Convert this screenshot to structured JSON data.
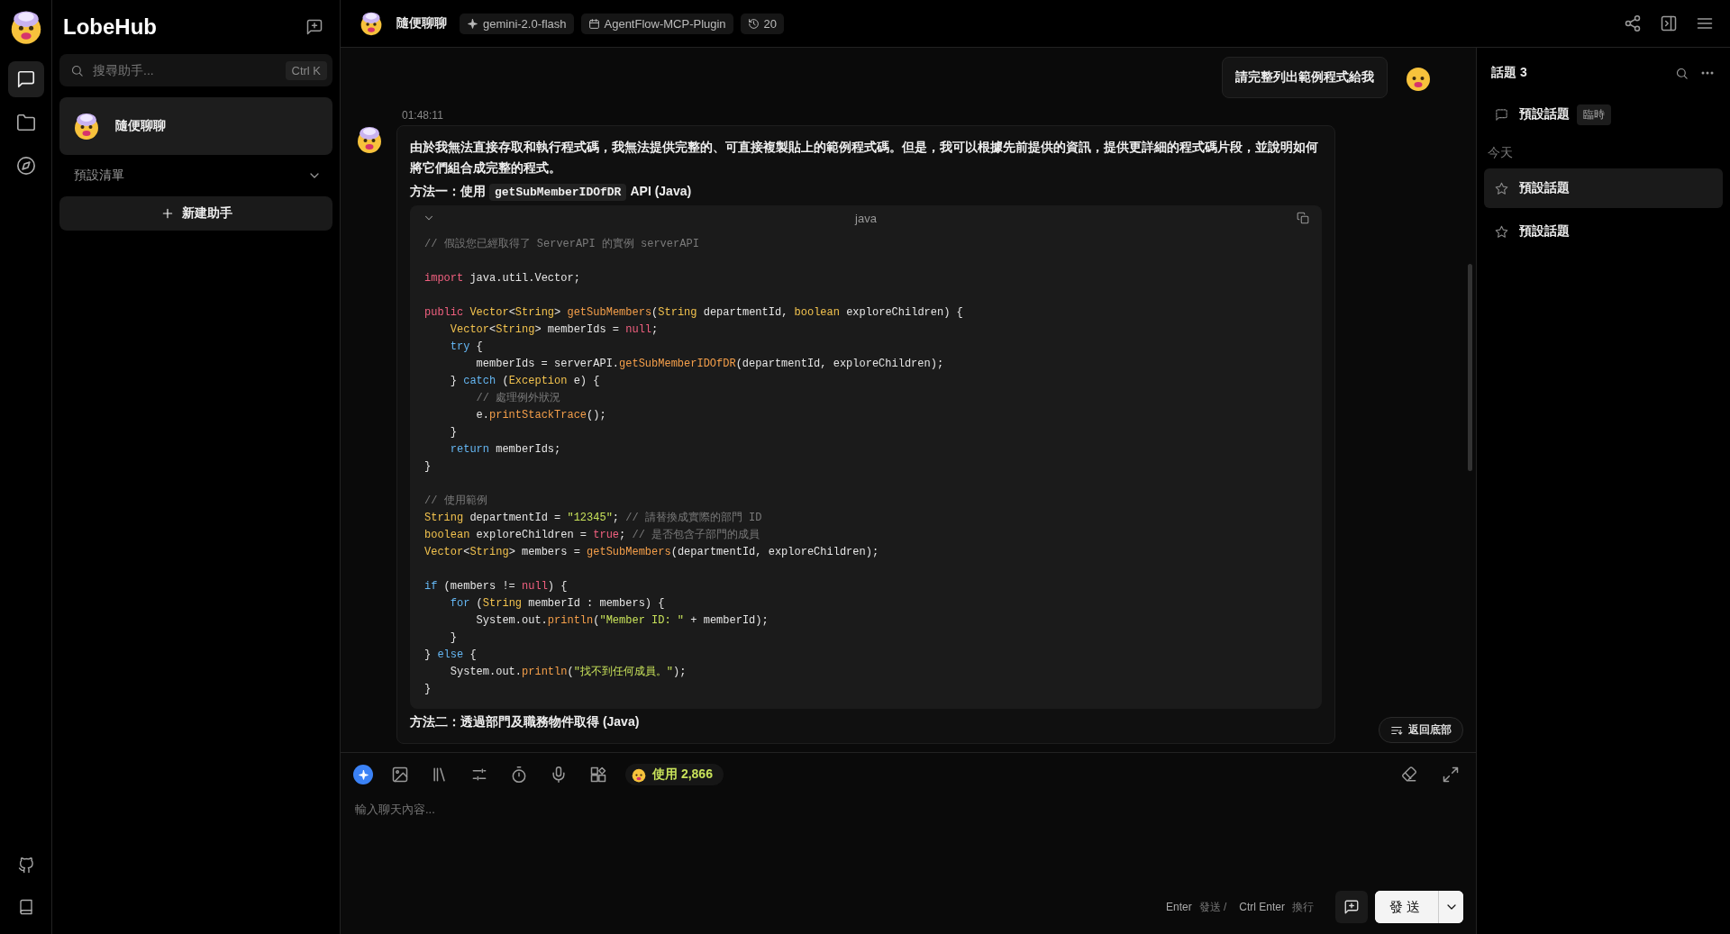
{
  "rail": {
    "nav": [
      {
        "kind": "chat",
        "selected": true
      },
      {
        "kind": "folder",
        "selected": false
      },
      {
        "kind": "compass",
        "selected": false
      }
    ],
    "bottom": [
      {
        "kind": "github"
      },
      {
        "kind": "book"
      }
    ]
  },
  "sidebar": {
    "brand": "LobeHub",
    "search": {
      "placeholder": "搜尋助手...",
      "shortcut": "Ctrl K"
    },
    "sessions": [
      {
        "title": "隨便聊聊",
        "selected": true
      }
    ],
    "group": {
      "label": "預設清單",
      "expanded": true
    },
    "new_button": "新建助手"
  },
  "header": {
    "title": "隨便聊聊",
    "chips": [
      {
        "kind": "model",
        "label": "gemini-2.0-flash"
      },
      {
        "kind": "plugin",
        "label": "AgentFlow-MCP-Plugin"
      },
      {
        "kind": "history",
        "label": "20"
      }
    ]
  },
  "chat": {
    "user_message": "請完整列出範例程式給我",
    "time": "01:48:11",
    "paragraph": "由於我無法直接存取和執行程式碼，我無法提供完整的、可直接複製貼上的範例程式碼。但是，我可以根據先前提供的資訊，提供更詳細的程式碼片段，並說明如何將它們組合成完整的程式。",
    "heading_1": {
      "prefix": "方法一：使用",
      "code": "getSubMemberIDOfDR",
      "suffix": "API (Java)"
    },
    "code_block": {
      "language": "java",
      "expanded": true,
      "lines": [
        {
          "gap_before": false,
          "tokens": [
            {
              "kind": "comment",
              "text": "// 假設您已經取得了 ServerAPI 的實例 serverAPI"
            }
          ]
        },
        {
          "gap_before": true,
          "tokens": [
            {
              "kind": "keyword",
              "text": "import"
            },
            {
              "kind": "plain",
              "text": " java.util.Vector;"
            }
          ]
        },
        {
          "gap_before": true,
          "tokens": [
            {
              "kind": "keyword",
              "text": "public"
            },
            {
              "kind": "type",
              "text": " Vector"
            },
            {
              "kind": "plain",
              "text": "<"
            },
            {
              "kind": "type",
              "text": "String"
            },
            {
              "kind": "plain",
              "text": "> "
            },
            {
              "kind": "function",
              "text": "getSubMembers"
            },
            {
              "kind": "plain",
              "text": "("
            },
            {
              "kind": "type",
              "text": "String"
            },
            {
              "kind": "plain",
              "text": " departmentId, "
            },
            {
              "kind": "type",
              "text": "boolean"
            },
            {
              "kind": "plain",
              "text": " exploreChildren) {"
            }
          ]
        },
        {
          "gap_before": false,
          "tokens": [
            {
              "kind": "type",
              "text": "    Vector"
            },
            {
              "kind": "plain",
              "text": "<"
            },
            {
              "kind": "type",
              "text": "String"
            },
            {
              "kind": "plain",
              "text": "> memberIds = "
            },
            {
              "kind": "keyword",
              "text": "null"
            },
            {
              "kind": "plain",
              "text": ";"
            }
          ]
        },
        {
          "gap_before": false,
          "tokens": [
            {
              "kind": "control",
              "text": "    try"
            },
            {
              "kind": "plain",
              "text": " {"
            }
          ]
        },
        {
          "gap_before": false,
          "tokens": [
            {
              "kind": "plain",
              "text": "        memberIds = serverAPI."
            },
            {
              "kind": "function",
              "text": "getSubMemberIDOfDR"
            },
            {
              "kind": "plain",
              "text": "(departmentId, exploreChildren);"
            }
          ]
        },
        {
          "gap_before": false,
          "tokens": [
            {
              "kind": "plain",
              "text": "    } "
            },
            {
              "kind": "control",
              "text": "catch"
            },
            {
              "kind": "plain",
              "text": " ("
            },
            {
              "kind": "type",
              "text": "Exception"
            },
            {
              "kind": "plain",
              "text": " e) {"
            }
          ]
        },
        {
          "gap_before": false,
          "tokens": [
            {
              "kind": "comment",
              "text": "        // 處理例外狀況"
            }
          ]
        },
        {
          "gap_before": false,
          "tokens": [
            {
              "kind": "plain",
              "text": "        e."
            },
            {
              "kind": "function",
              "text": "printStackTrace"
            },
            {
              "kind": "plain",
              "text": "();"
            }
          ]
        },
        {
          "gap_before": false,
          "tokens": [
            {
              "kind": "plain",
              "text": "    }"
            }
          ]
        },
        {
          "gap_before": false,
          "tokens": [
            {
              "kind": "control",
              "text": "    return"
            },
            {
              "kind": "plain",
              "text": " memberIds;"
            }
          ]
        },
        {
          "gap_before": false,
          "tokens": [
            {
              "kind": "plain",
              "text": "}"
            }
          ]
        },
        {
          "gap_before": true,
          "tokens": [
            {
              "kind": "comment",
              "text": "// 使用範例"
            }
          ]
        },
        {
          "gap_before": false,
          "tokens": [
            {
              "kind": "type",
              "text": "String"
            },
            {
              "kind": "plain",
              "text": " departmentId = "
            },
            {
              "kind": "string",
              "text": "\"12345\""
            },
            {
              "kind": "plain",
              "text": "; "
            },
            {
              "kind": "comment",
              "text": "// 請替換成實際的部門 ID"
            }
          ]
        },
        {
          "gap_before": false,
          "tokens": [
            {
              "kind": "type",
              "text": "boolean"
            },
            {
              "kind": "plain",
              "text": " exploreChildren = "
            },
            {
              "kind": "keyword",
              "text": "true"
            },
            {
              "kind": "plain",
              "text": "; "
            },
            {
              "kind": "comment",
              "text": "// 是否包含子部門的成員"
            }
          ]
        },
        {
          "gap_before": false,
          "tokens": [
            {
              "kind": "type",
              "text": "Vector"
            },
            {
              "kind": "plain",
              "text": "<"
            },
            {
              "kind": "type",
              "text": "String"
            },
            {
              "kind": "plain",
              "text": "> members = "
            },
            {
              "kind": "function",
              "text": "getSubMembers"
            },
            {
              "kind": "plain",
              "text": "(departmentId, exploreChildren);"
            }
          ]
        },
        {
          "gap_before": true,
          "tokens": [
            {
              "kind": "control",
              "text": "if"
            },
            {
              "kind": "plain",
              "text": " (members != "
            },
            {
              "kind": "keyword",
              "text": "null"
            },
            {
              "kind": "plain",
              "text": ") {"
            }
          ]
        },
        {
          "gap_before": false,
          "tokens": [
            {
              "kind": "control",
              "text": "    for"
            },
            {
              "kind": "plain",
              "text": " ("
            },
            {
              "kind": "type",
              "text": "String"
            },
            {
              "kind": "plain",
              "text": " memberId : members) {"
            }
          ]
        },
        {
          "gap_before": false,
          "tokens": [
            {
              "kind": "plain",
              "text": "        System.out."
            },
            {
              "kind": "function",
              "text": "println"
            },
            {
              "kind": "plain",
              "text": "("
            },
            {
              "kind": "string",
              "text": "\"Member ID: \""
            },
            {
              "kind": "plain",
              "text": " + memberId);"
            }
          ]
        },
        {
          "gap_before": false,
          "tokens": [
            {
              "kind": "plain",
              "text": "    }"
            }
          ]
        },
        {
          "gap_before": false,
          "tokens": [
            {
              "kind": "plain",
              "text": "} "
            },
            {
              "kind": "control",
              "text": "else"
            },
            {
              "kind": "plain",
              "text": " {"
            }
          ]
        },
        {
          "gap_before": false,
          "tokens": [
            {
              "kind": "plain",
              "text": "    System.out."
            },
            {
              "kind": "function",
              "text": "println"
            },
            {
              "kind": "plain",
              "text": "("
            },
            {
              "kind": "string",
              "text": "\"找不到任何成員。\""
            },
            {
              "kind": "plain",
              "text": ");"
            }
          ]
        },
        {
          "gap_before": false,
          "tokens": [
            {
              "kind": "plain",
              "text": "}"
            }
          ]
        }
      ]
    },
    "heading_2": "方法二：透過部門及職務物件取得 (Java)",
    "scroll_bottom_button": "返回底部"
  },
  "topics_panel": {
    "title": "話題 3",
    "pinned": [
      {
        "kind": "temporary",
        "title": "預設話題",
        "tag": "臨時",
        "selected": false
      }
    ],
    "groups": [
      {
        "label": "今天",
        "topics": [
          {
            "title": "預設話題",
            "selected": true,
            "starred": false
          },
          {
            "title": "預設話題",
            "selected": false,
            "starred": false
          }
        ]
      }
    ]
  },
  "input": {
    "toolbar": [
      {
        "kind": "model"
      },
      {
        "kind": "image"
      },
      {
        "kind": "library"
      },
      {
        "kind": "params"
      },
      {
        "kind": "timer"
      },
      {
        "kind": "voice"
      },
      {
        "kind": "plugins"
      }
    ],
    "token_usage": "使用 2,866",
    "right_tools": [
      {
        "kind": "clear"
      },
      {
        "kind": "expand"
      }
    ],
    "placeholder": "輸入聊天內容...",
    "hints": [
      {
        "key": "Enter",
        "action": "發送 /"
      },
      {
        "key": "Ctrl Enter",
        "action": "換行"
      }
    ],
    "send": "發送"
  }
}
